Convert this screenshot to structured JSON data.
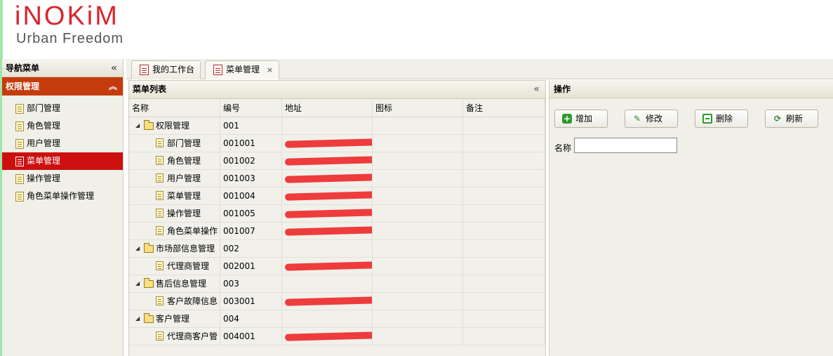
{
  "brand": {
    "logo_text": "iNOKiM",
    "tagline": "Urban  Freedom",
    "brand_color": "#d8262d"
  },
  "sidebar": {
    "title": "导航菜单",
    "group": "权限管理",
    "items": [
      {
        "label": "部门管理"
      },
      {
        "label": "角色管理"
      },
      {
        "label": "用户管理"
      },
      {
        "label": "菜单管理",
        "active": true
      },
      {
        "label": "操作管理"
      },
      {
        "label": "角色菜单操作管理"
      }
    ]
  },
  "tabs": [
    {
      "label": "我的工作台"
    },
    {
      "label": "菜单管理",
      "active": true,
      "close": "×"
    }
  ],
  "menu_list": {
    "title": "菜单列表",
    "columns": [
      "名称",
      "编号",
      "地址",
      "图标",
      "备注"
    ],
    "rows": [
      {
        "name": "权限管理",
        "code": "001",
        "type": "folder"
      },
      {
        "name": "部门管理",
        "code": "001001",
        "type": "doc",
        "address_redacted": true
      },
      {
        "name": "角色管理",
        "code": "001002",
        "type": "doc",
        "address_redacted": true
      },
      {
        "name": "用户管理",
        "code": "001003",
        "type": "doc",
        "address_redacted": true
      },
      {
        "name": "菜单管理",
        "code": "001004",
        "type": "doc",
        "address_redacted": true
      },
      {
        "name": "操作管理",
        "code": "001005",
        "type": "doc",
        "address_redacted": true
      },
      {
        "name": "角色菜单操作",
        "code": "001007",
        "type": "doc",
        "address_redacted": true
      },
      {
        "name": "市场部信息管理",
        "code": "002",
        "type": "folder"
      },
      {
        "name": "代理商管理",
        "code": "002001",
        "type": "doc",
        "address_redacted": true
      },
      {
        "name": "售后信息管理",
        "code": "003",
        "type": "folder"
      },
      {
        "name": "客户故障信息",
        "code": "003001",
        "type": "doc",
        "address_redacted": true
      },
      {
        "name": "客户管理",
        "code": "004",
        "type": "folder"
      },
      {
        "name": "代理商客户管",
        "code": "004001",
        "type": "doc",
        "address_redacted": true
      }
    ]
  },
  "operations": {
    "title": "操作",
    "buttons": {
      "add": "增加",
      "edit": "修改",
      "delete": "删除",
      "refresh": "刷新"
    },
    "name_label": "名称",
    "name_value": ""
  },
  "colors": {
    "group_header": "#c43c0c",
    "active_item": "#cc1010",
    "redaction": "#ee2c2c"
  }
}
